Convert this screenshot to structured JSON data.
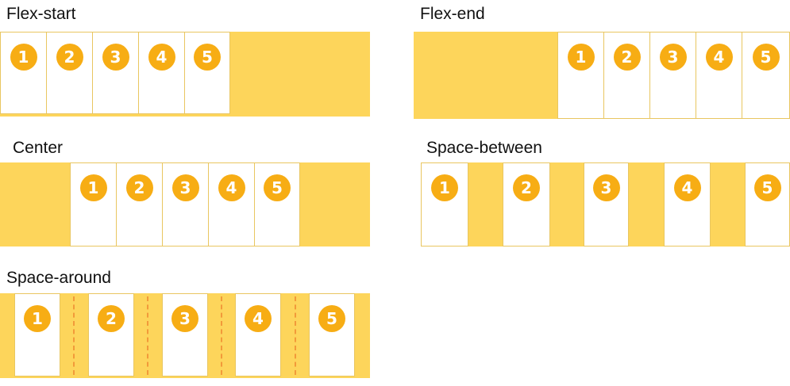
{
  "panels": [
    {
      "id": "flex-start",
      "title": "Flex-start",
      "items": [
        "1",
        "2",
        "3",
        "4",
        "5"
      ]
    },
    {
      "id": "flex-end",
      "title": "Flex-end",
      "items": [
        "1",
        "2",
        "3",
        "4",
        "5"
      ]
    },
    {
      "id": "center",
      "title": "Center",
      "items": [
        "1",
        "2",
        "3",
        "4",
        "5"
      ]
    },
    {
      "id": "space-between",
      "title": "Space-between",
      "items": [
        "1",
        "2",
        "3",
        "4",
        "5"
      ]
    },
    {
      "id": "space-around",
      "title": "Space-around",
      "items": [
        "1",
        "2",
        "3",
        "4",
        "5"
      ]
    }
  ],
  "colors": {
    "container": "#fdd55b",
    "item": "#ffffff",
    "badge": "#f7ad14",
    "divider": "#f29a3a"
  }
}
